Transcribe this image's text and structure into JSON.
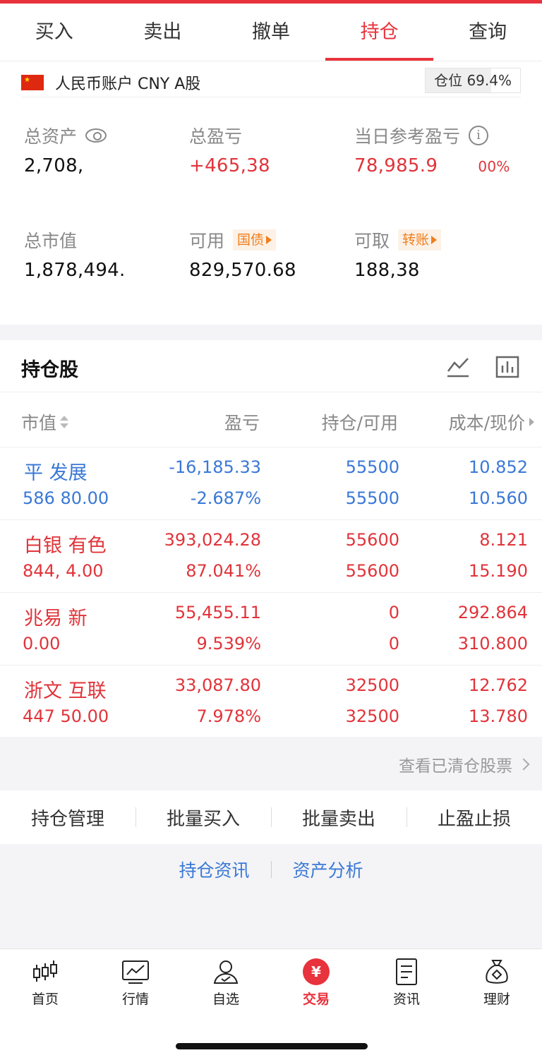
{
  "tabs": [
    {
      "label": "买入"
    },
    {
      "label": "卖出"
    },
    {
      "label": "撤单"
    },
    {
      "label": "持仓"
    },
    {
      "label": "查询"
    }
  ],
  "account": {
    "label": "人民币账户 CNY A股",
    "position_chip": "仓位 69.4%",
    "position_ratio": 0.694
  },
  "assets": {
    "total_assets_label": "总资产",
    "total_assets_value": "2,708,",
    "total_pl_label": "总盈亏",
    "total_pl_value": "+465,38",
    "daily_pl_label": "当日参考盈亏",
    "daily_pl_value": "78,985.9",
    "daily_pl_suffix": "00%",
    "market_value_label": "总市值",
    "market_value_value": "1,878,494.",
    "available_label": "可用",
    "available_tag": "国债",
    "available_value": "829,570.68",
    "withdrawable_label": "可取",
    "withdrawable_tag": "转账",
    "withdrawable_value": "188,38"
  },
  "holdings": {
    "title": "持仓股",
    "columns": {
      "market_value": "市值",
      "pl": "盈亏",
      "qty": "持仓/可用",
      "cost": "成本/现价"
    },
    "rows": [
      {
        "name": "平 发展",
        "mv": "586 80.00",
        "pl": "-16,185.33",
        "pl_pct": "-2.687%",
        "qty": "55500",
        "avail": "55500",
        "cost": "10.852",
        "price": "10.560",
        "color": "#3a78d6"
      },
      {
        "name": "白银 有色",
        "mv": "844, 4.00",
        "pl": "393,024.28",
        "pl_pct": "87.041%",
        "qty": "55600",
        "avail": "55600",
        "cost": "8.121",
        "price": "15.190",
        "color": "#e0343a"
      },
      {
        "name": "兆易 新",
        "mv": "0.00",
        "pl": "55,455.11",
        "pl_pct": "9.539%",
        "qty": "0",
        "avail": "0",
        "cost": "292.864",
        "price": "310.800",
        "color": "#e0343a"
      },
      {
        "name": "浙文 互联",
        "mv": "447 50.00",
        "pl": "33,087.80",
        "pl_pct": "7.978%",
        "qty": "32500",
        "avail": "32500",
        "cost": "12.762",
        "price": "13.780",
        "color": "#e0343a"
      }
    ]
  },
  "cleared_link": "查看已清仓股票",
  "actions": [
    "持仓管理",
    "批量买入",
    "批量卖出",
    "止盈止损"
  ],
  "info_links": [
    "持仓资讯",
    "资产分析"
  ],
  "nav": [
    {
      "label": "首页",
      "icon": "candlestick-icon"
    },
    {
      "label": "行情",
      "icon": "chart-icon"
    },
    {
      "label": "自选",
      "icon": "user-icon"
    },
    {
      "label": "交易",
      "icon": "yuan-icon"
    },
    {
      "label": "资讯",
      "icon": "document-icon"
    },
    {
      "label": "理财",
      "icon": "moneybag-icon"
    }
  ],
  "colors": {
    "accent": "#e8323c",
    "up": "#e0343a",
    "down": "#3a78d6",
    "tag": "#f07e1c"
  }
}
